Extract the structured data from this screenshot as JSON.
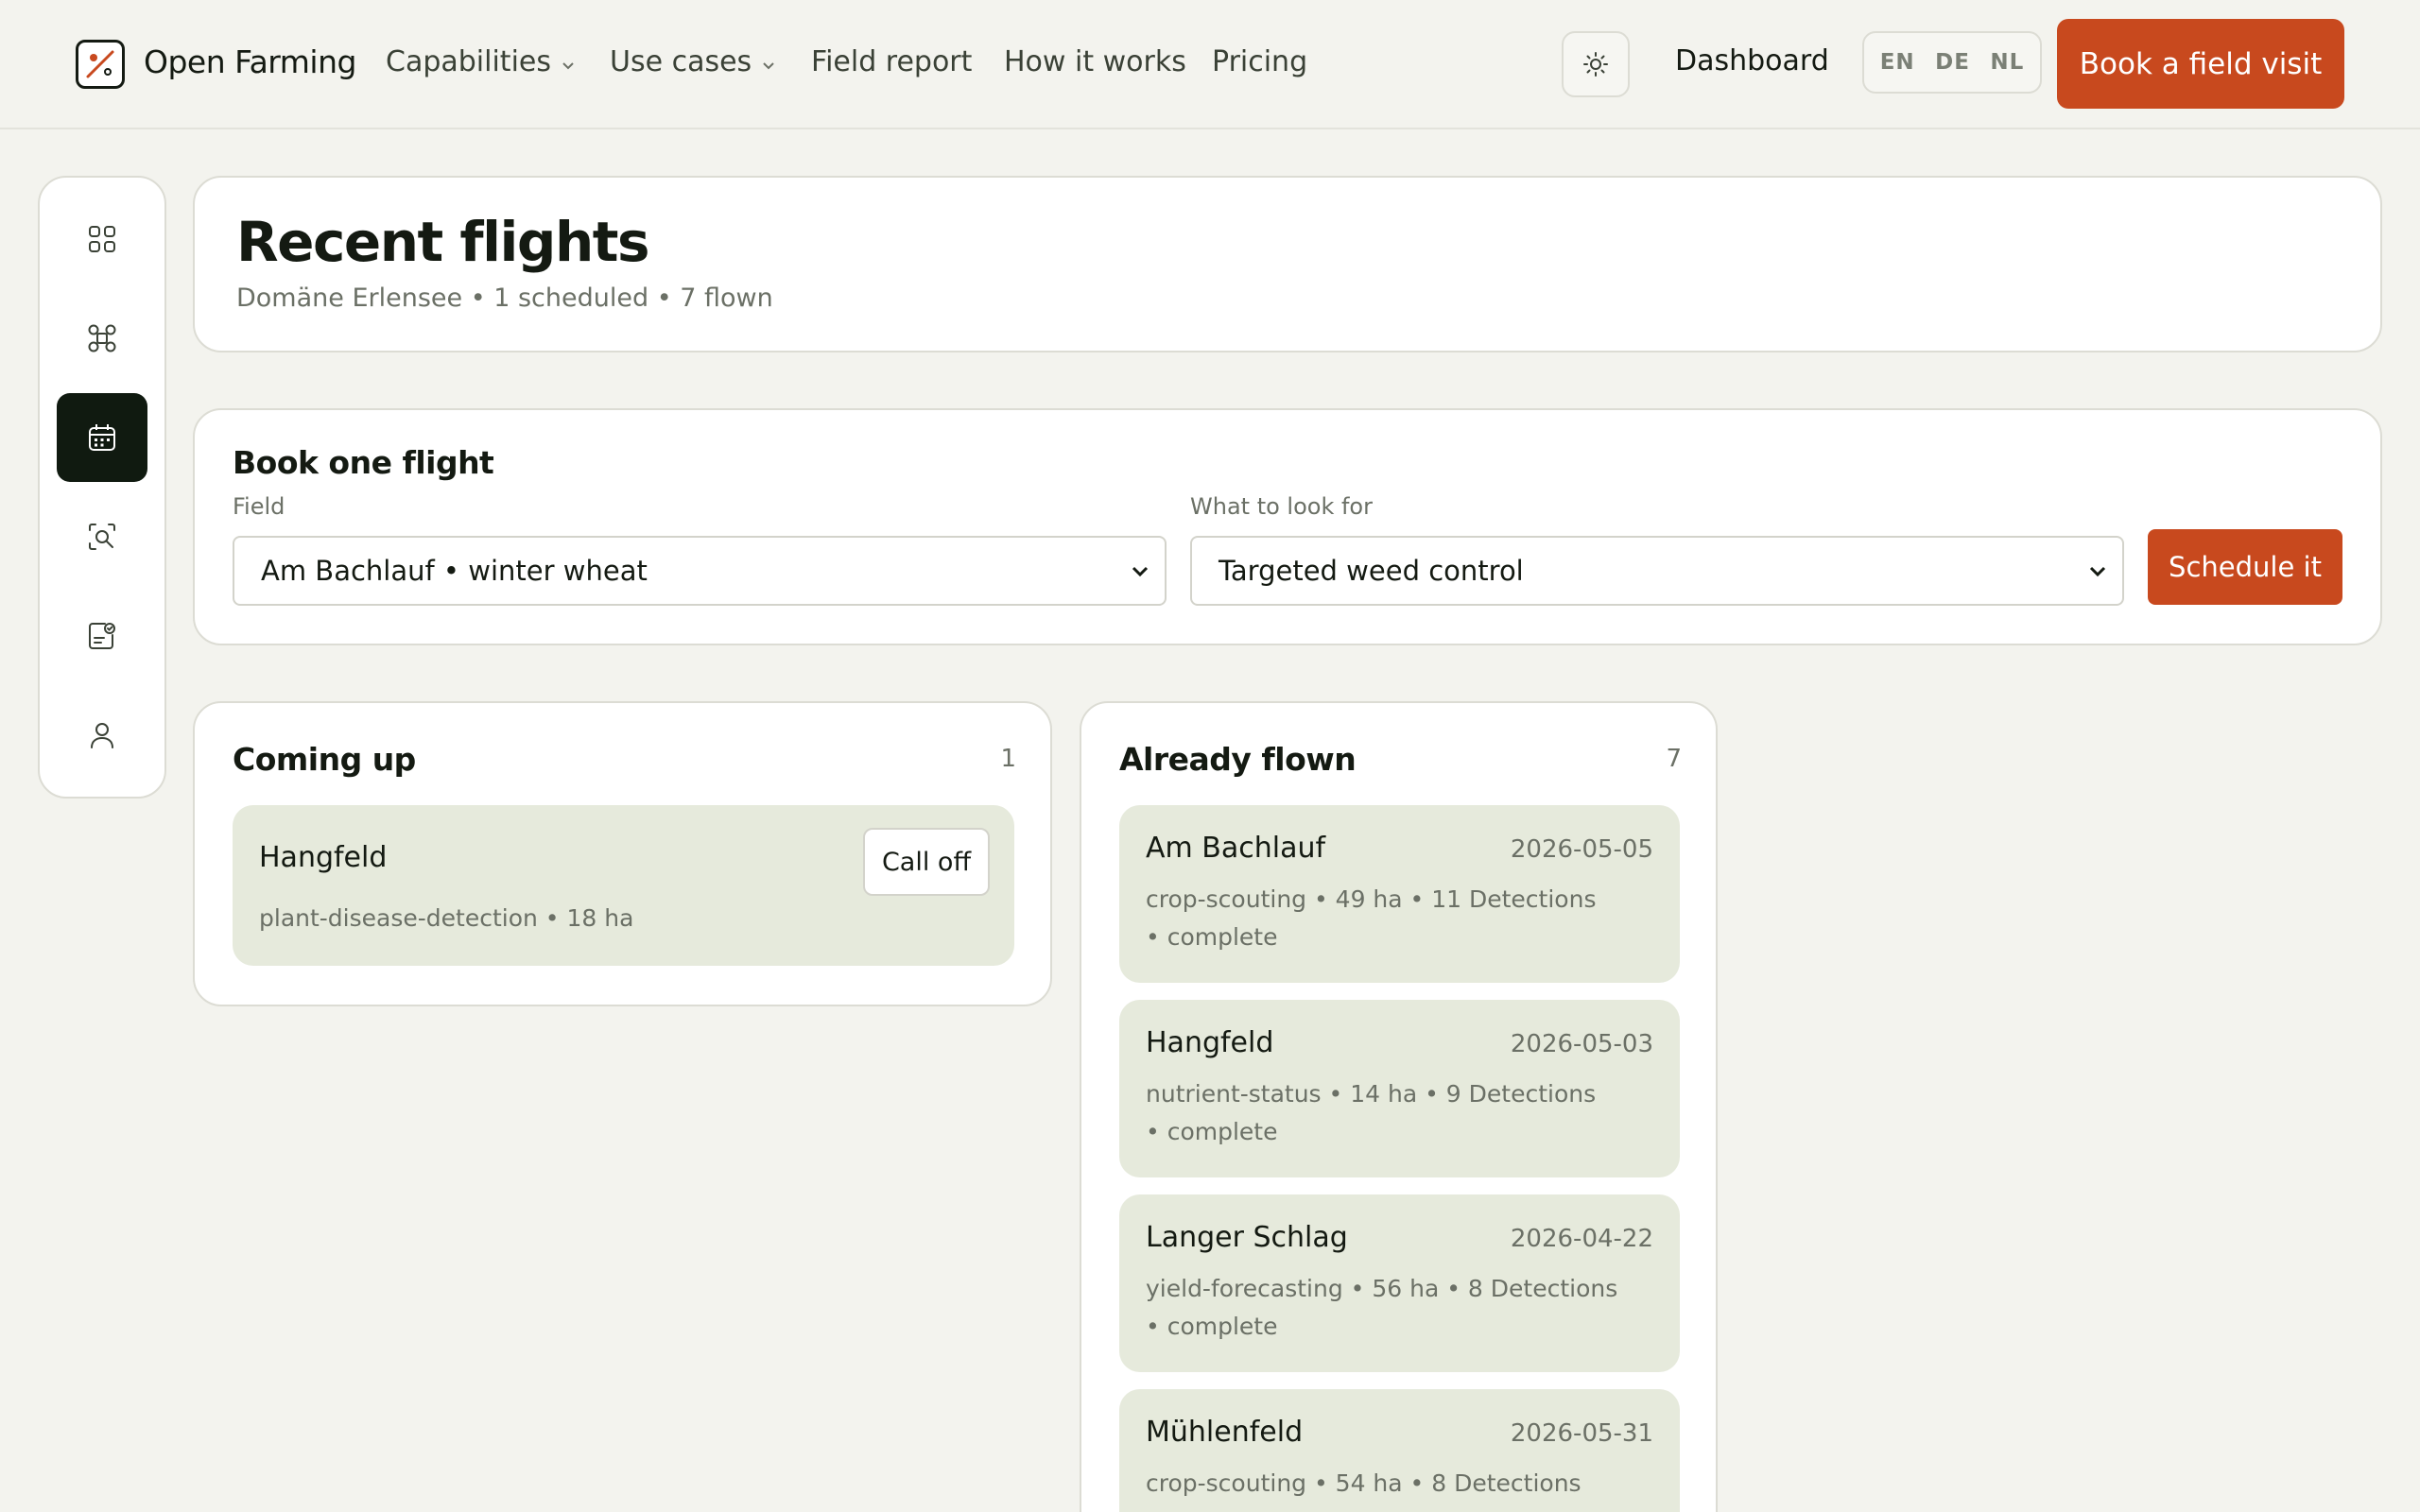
{
  "brand": {
    "name": "Open Farming"
  },
  "nav": {
    "capabilities": "Capabilities",
    "use_cases": "Use cases",
    "field_report": "Field report",
    "how_it_works": "How it works",
    "pricing": "Pricing",
    "dashboard": "Dashboard",
    "languages": [
      "EN",
      "DE",
      "NL"
    ],
    "cta": "Book a field visit"
  },
  "sidebar": {
    "items": [
      {
        "icon": "grid-icon",
        "active": false
      },
      {
        "icon": "drone-icon",
        "active": false
      },
      {
        "icon": "calendar-icon",
        "active": true
      },
      {
        "icon": "scan-search-icon",
        "active": false
      },
      {
        "icon": "report-check-icon",
        "active": false
      },
      {
        "icon": "user-icon",
        "active": false
      }
    ]
  },
  "page": {
    "title": "Recent flights",
    "subtitle": "Domäne Erlensee • 1 scheduled • 7 flown"
  },
  "booking": {
    "title": "Book one flight",
    "field_label": "Field",
    "field_value": "Am Bachlauf • winter wheat",
    "look_label": "What to look for",
    "look_value": "Targeted weed control",
    "submit": "Schedule it"
  },
  "coming_up": {
    "title": "Coming up",
    "count": "1",
    "items": [
      {
        "name": "Hangfeld",
        "meta": "plant-disease-detection • 18 ha",
        "action": "Call off"
      }
    ]
  },
  "flown": {
    "title": "Already flown",
    "count": "7",
    "items": [
      {
        "name": "Am Bachlauf",
        "date": "2026-05-05",
        "meta": "crop-scouting • 49 ha • 11 Detections",
        "meta2": "• complete"
      },
      {
        "name": "Hangfeld",
        "date": "2026-05-03",
        "meta": "nutrient-status • 14 ha • 9 Detections",
        "meta2": "• complete"
      },
      {
        "name": "Langer Schlag",
        "date": "2026-04-22",
        "meta": "yield-forecasting • 56 ha • 8 Detections",
        "meta2": "• complete"
      },
      {
        "name": "Mühlenfeld",
        "date": "2026-05-31",
        "meta": "crop-scouting • 54 ha • 8 Detections",
        "meta2": ""
      }
    ]
  },
  "colors": {
    "accent": "#c8491e",
    "background": "#f3f3ee",
    "item_bg": "#e6eadc",
    "active_nav": "#101a10"
  }
}
